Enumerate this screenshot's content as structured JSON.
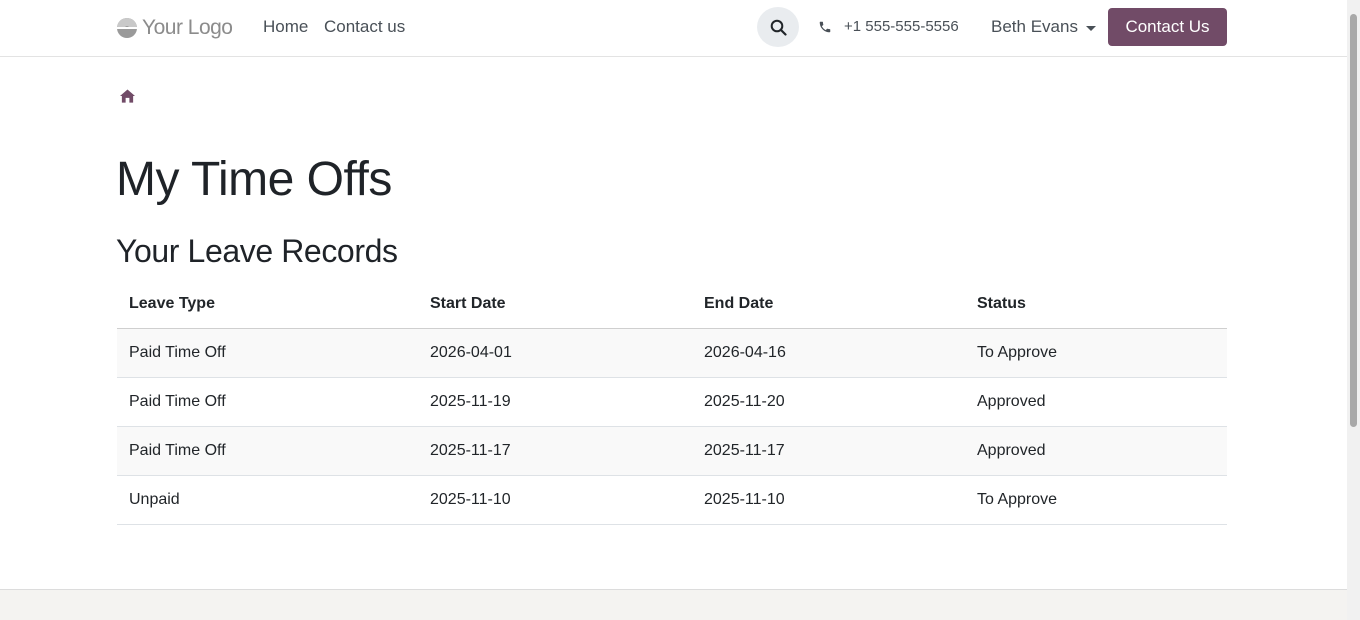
{
  "header": {
    "logo_text": "Your Logo",
    "nav": [
      {
        "label": "Home"
      },
      {
        "label": "Contact us"
      }
    ],
    "phone": "+1 555-555-5556",
    "user_name": "Beth Evans",
    "cta_label": "Contact Us"
  },
  "main": {
    "title": "My Time Offs",
    "section_title": "Your Leave Records",
    "table": {
      "columns": [
        "Leave Type",
        "Start Date",
        "End Date",
        "Status"
      ],
      "rows": [
        [
          "Paid Time Off",
          "2026-04-01",
          "2026-04-16",
          "To Approve"
        ],
        [
          "Paid Time Off",
          "2025-11-19",
          "2025-11-20",
          "Approved"
        ],
        [
          "Paid Time Off",
          "2025-11-17",
          "2025-11-17",
          "Approved"
        ],
        [
          "Unpaid",
          "2025-11-10",
          "2025-11-10",
          "To Approve"
        ]
      ]
    }
  },
  "colors": {
    "brand": "#714b67",
    "text": "#212529",
    "muted": "#495057"
  },
  "icons": {
    "search": "search-icon",
    "phone": "phone-icon",
    "home": "home-icon"
  }
}
